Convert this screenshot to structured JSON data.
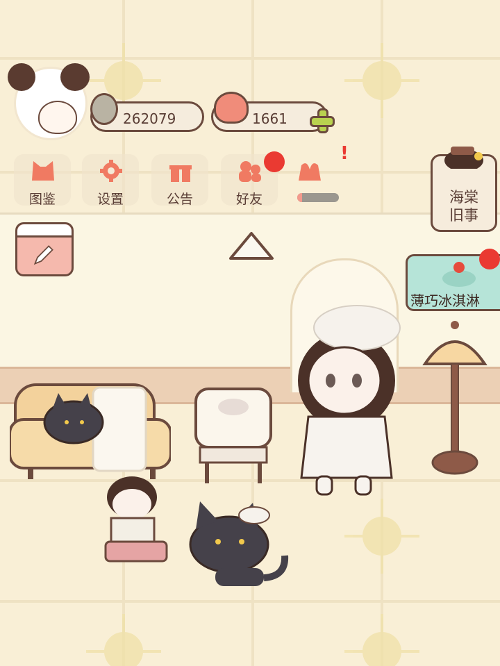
{
  "hud": {
    "fish_currency": "262079",
    "heart_currency": "1661"
  },
  "nav": [
    {
      "label": "图鉴",
      "icon": "cat-face-icon"
    },
    {
      "label": "设置",
      "icon": "gear-icon"
    },
    {
      "label": "公告",
      "icon": "gift-icon"
    },
    {
      "label": "好友",
      "icon": "friends-icon"
    }
  ],
  "event_progress": 0.12,
  "story": {
    "title": "海棠\n旧事"
  },
  "banner": {
    "label": "薄巧冰淇淋"
  },
  "colors": {
    "accent": "#f07a62",
    "outline": "#6b4a3d",
    "notification": "#ea3a32",
    "plus": "#b9d24f",
    "floor": "#f9efd6"
  }
}
